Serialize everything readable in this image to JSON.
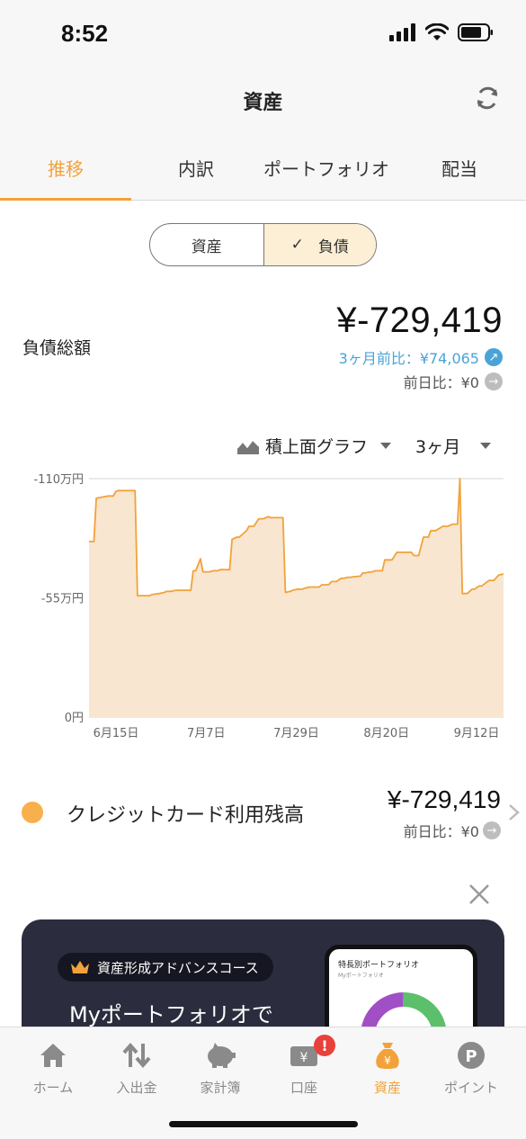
{
  "status_bar": {
    "time": "8:52"
  },
  "header": {
    "title": "資産"
  },
  "tabs": [
    {
      "label": "推移",
      "active": true
    },
    {
      "label": "内訳",
      "active": false
    },
    {
      "label": "ポートフォリオ",
      "active": false
    },
    {
      "label": "配当",
      "active": false
    }
  ],
  "segment": {
    "assets_label": "資産",
    "liabilities_label": "負債",
    "selected": "負債"
  },
  "summary": {
    "label": "負債総額",
    "total": "¥-729,419",
    "three_month_change": "3ヶ月前比：¥74,065",
    "day_change": "前日比：¥0"
  },
  "graph_controls": {
    "graph_type": "積上面グラフ",
    "period": "3ヶ月"
  },
  "chart_data": {
    "type": "area",
    "y_tick_labels": [
      "-110万円",
      "-55万円",
      "0円"
    ],
    "x_tick_labels": [
      "6月15日",
      "7月7日",
      "7月29日",
      "8月20日",
      "9月12日"
    ],
    "ylim": [
      0,
      1100000
    ],
    "grid": true,
    "fill_color": "#f8e6d0",
    "line_color": "#f2a23a",
    "x": [
      0,
      2,
      3,
      8,
      10,
      11,
      12,
      19,
      20,
      25,
      26,
      29,
      31,
      32,
      34,
      35,
      36,
      39,
      42,
      43,
      44,
      46,
      47,
      48,
      50,
      51,
      53,
      54,
      58,
      59,
      61,
      62,
      65,
      66,
      68,
      70,
      72,
      74,
      75,
      77,
      80,
      81,
      83,
      84,
      86,
      88,
      89,
      91,
      95,
      96,
      98,
      99,
      100,
      102,
      104,
      105,
      107,
      108,
      109,
      112,
      113,
      114,
      116,
      117,
      118,
      121,
      122,
      125,
      127,
      130,
      133,
      134,
      136,
      138,
      140,
      141,
      143,
      146,
      148,
      150,
      152,
      153,
      154,
      156,
      158,
      159,
      161,
      162,
      165,
      167,
      169,
      171
    ],
    "y": [
      810000,
      810000,
      1010000,
      1020000,
      1020000,
      1040000,
      1045000,
      1045000,
      560000,
      560000,
      565000,
      570000,
      575000,
      580000,
      580000,
      583000,
      585000,
      585000,
      585000,
      675000,
      675000,
      730000,
      670000,
      670000,
      670000,
      675000,
      675000,
      680000,
      680000,
      820000,
      830000,
      830000,
      860000,
      880000,
      880000,
      915000,
      915000,
      925000,
      920000,
      920000,
      920000,
      575000,
      580000,
      585000,
      590000,
      590000,
      595000,
      600000,
      600000,
      610000,
      610000,
      612000,
      625000,
      625000,
      640000,
      640000,
      645000,
      645000,
      647000,
      650000,
      665000,
      665000,
      670000,
      670000,
      675000,
      675000,
      725000,
      725000,
      760000,
      760000,
      760000,
      745000,
      745000,
      830000,
      830000,
      860000,
      860000,
      880000,
      880000,
      890000,
      890000,
      1100000,
      570000,
      570000,
      590000,
      590000,
      605000,
      605000,
      630000,
      630000,
      655000,
      660000
    ]
  },
  "breakdown": {
    "color": "#f8b04c",
    "label": "クレジットカード利用残高",
    "value": "¥-729,419",
    "day_change": "前日比：¥0"
  },
  "banner": {
    "pill_text": "資産形成アドバンスコース",
    "headline": "Myポートフォリオで",
    "phone_title": "特長別ポートフォリオ",
    "phone_subtitle": "Myポートフォリオ"
  },
  "bottom_nav": [
    {
      "label": "ホーム",
      "icon": "home-icon"
    },
    {
      "label": "入出金",
      "icon": "transfer-arrows-icon"
    },
    {
      "label": "家計簿",
      "icon": "piggy-bank-icon"
    },
    {
      "label": "口座",
      "icon": "account-card-icon",
      "badge": "!"
    },
    {
      "label": "資産",
      "icon": "money-bag-icon",
      "active": true
    },
    {
      "label": "ポイント",
      "icon": "points-icon"
    }
  ],
  "colors": {
    "accent": "#f2a23a",
    "link_blue": "#4aa3d6",
    "badge_red": "#e8413b",
    "banner_bg": "#2b2d3e"
  }
}
